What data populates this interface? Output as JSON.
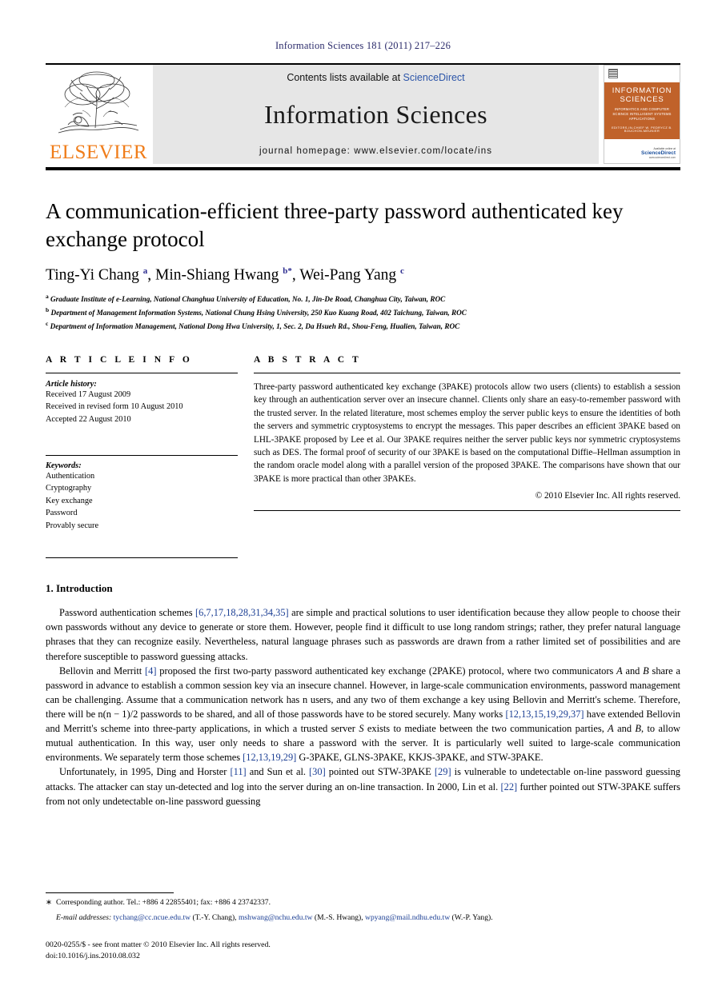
{
  "running_head": "Information Sciences 181 (2011) 217–226",
  "banner": {
    "contents_prefix": "Contents lists available at ",
    "contents_link": "ScienceDirect",
    "journal_name": "Information Sciences",
    "homepage": "journal homepage: www.elsevier.com/locate/ins",
    "publisher_wordmark": "ELSEVIER",
    "cover": {
      "title_line1": "INFORMATION",
      "title_line2": "SCIENCES",
      "subtitle": "INFORMATICS AND COMPUTER SCIENCE\nINTELLIGENT SYSTEMS\nAPPLICATIONS",
      "editors": "EDITORS-IN-CHIEF  W. PEDRYCZ  B. BOUCHON-MEUNIER",
      "foot_small": "Available online at",
      "foot_brand": "ScienceDirect",
      "foot_url": "www.sciencedirect.com"
    },
    "accent_orange": "#f07d1a",
    "accent_link_blue": "#2c55a8",
    "cover_band_color": "#c0622a"
  },
  "article": {
    "title": "A communication-efficient three-party password authenticated key exchange protocol",
    "authors_html": "Ting-Yi Chang <sup>a</sup>, Min-Shiang Hwang <sup>b*</sup>, Wei-Pang Yang <sup>c</sup>",
    "affiliations": [
      {
        "marker": "a",
        "text": "Graduate Institute of e-Learning, National Changhua University of Education, No. 1, Jin-De Road, Changhua City, Taiwan, ROC"
      },
      {
        "marker": "b",
        "text": "Department of Management Information Systems, National Chung Hsing University, 250 Kuo Kuang Road, 402 Taichung, Taiwan, ROC"
      },
      {
        "marker": "c",
        "text": "Department of Information Management, National Dong Hwa University, 1, Sec. 2, Da Hsueh Rd., Shou-Feng, Hualien, Taiwan, ROC"
      }
    ]
  },
  "article_info": {
    "heading": "A R T I C L E    I N F O",
    "history_label": "Article history:",
    "history": [
      "Received 17 August 2009",
      "Received in revised form 10 August 2010",
      "Accepted 22 August 2010"
    ],
    "keywords_label": "Keywords:",
    "keywords": [
      "Authentication",
      "Cryptography",
      "Key exchange",
      "Password",
      "Provably secure"
    ]
  },
  "abstract": {
    "heading": "A B S T R A C T",
    "text": "Three-party password authenticated key exchange (3PAKE) protocols allow two users (clients) to establish a session key through an authentication server over an insecure channel. Clients only share an easy-to-remember password with the trusted server. In the related literature, most schemes employ the server public keys to ensure the identities of both the servers and symmetric cryptosystems to encrypt the messages. This paper describes an efficient 3PAKE based on LHL-3PAKE proposed by Lee et al. Our 3PAKE requires neither the server public keys nor symmetric cryptosystems such as DES. The formal proof of security of our 3PAKE is based on the computational Diffie–Hellman assumption in the random oracle model along with a parallel version of the proposed 3PAKE. The comparisons have shown that our 3PAKE is more practical than other 3PAKEs.",
    "copyright": "© 2010 Elsevier Inc. All rights reserved."
  },
  "body": {
    "section_heading": "1. Introduction",
    "paragraph1_a": "Password authentication schemes ",
    "paragraph1_cite1": "[6,7,17,18,28,31,34,35]",
    "paragraph1_b": " are simple and practical solutions to user identification because they allow people to choose their own passwords without any device to generate or store them. However, people find it difficult to use long random strings; rather, they prefer natural language phrases that they can recognize easily. Nevertheless, natural language phrases such as passwords are drawn from a rather limited set of possibilities and are therefore susceptible to password guessing attacks.",
    "paragraph2_a": "Bellovin and Merritt ",
    "paragraph2_cite1": "[4]",
    "paragraph2_b": " proposed the first two-party password authenticated key exchange (2PAKE) protocol, where two communicators ",
    "paragraph2_A": "A",
    "paragraph2_c": " and ",
    "paragraph2_B": "B",
    "paragraph2_d": " share a password in advance to establish a common session key via an insecure channel. However, in large-scale communication environments, password management can be challenging. Assume that a communication network has n users, and any two of them exchange a key using Bellovin and Merritt's scheme. Therefore, there will be n(n − 1)/2 passwords to be shared, and all of those passwords have to be stored securely. Many works ",
    "paragraph2_cite2": "[12,13,15,19,29,37]",
    "paragraph2_e": " have extended Bellovin and Merritt's scheme into three-party applications, in which a trusted server ",
    "paragraph2_S": "S",
    "paragraph2_f": " exists to mediate between the two communication parties, ",
    "paragraph2_g": ", to allow mutual authentication. In this way, user only needs to share a password with the server. It is particularly well suited to large-scale communication environments. We separately term those schemes ",
    "paragraph2_cite3": "[12,13,19,29]",
    "paragraph2_h": " G-3PAKE, GLNS-3PAKE, KKJS-3PAKE, and STW-3PAKE.",
    "paragraph3_a": "Unfortunately, in 1995, Ding and Horster ",
    "paragraph3_cite1": "[11]",
    "paragraph3_b": " and Sun et al. ",
    "paragraph3_cite2": "[30]",
    "paragraph3_c": " pointed out STW-3PAKE ",
    "paragraph3_cite3": "[29]",
    "paragraph3_d": " is vulnerable to undetectable on-line password guessing attacks. The attacker can stay un-detected and log into the server during an on-line transaction. In 2000, Lin et al. ",
    "paragraph3_cite4": "[22]",
    "paragraph3_e": " further pointed out STW-3PAKE suffers from not only undetectable on-line password guessing"
  },
  "footnotes": {
    "corresponding_marker": "∗",
    "corresponding": "Corresponding author. Tel.: +886 4 22855401; fax: +886 4 23742337.",
    "email_label": "E-mail addresses:",
    "emails": [
      {
        "address": "tychang@cc.ncue.edu.tw",
        "who": "(T.-Y. Chang)"
      },
      {
        "address": "mshwang@nchu.edu.tw",
        "who": "(M.-S. Hwang)"
      },
      {
        "address": "wpyang@mail.ndhu.edu.tw",
        "who": "(W.-P. Yang)"
      }
    ],
    "issn_line": "0020-0255/$ - see front matter © 2010 Elsevier Inc. All rights reserved.",
    "doi_line": "doi:10.1016/j.ins.2010.08.032"
  }
}
